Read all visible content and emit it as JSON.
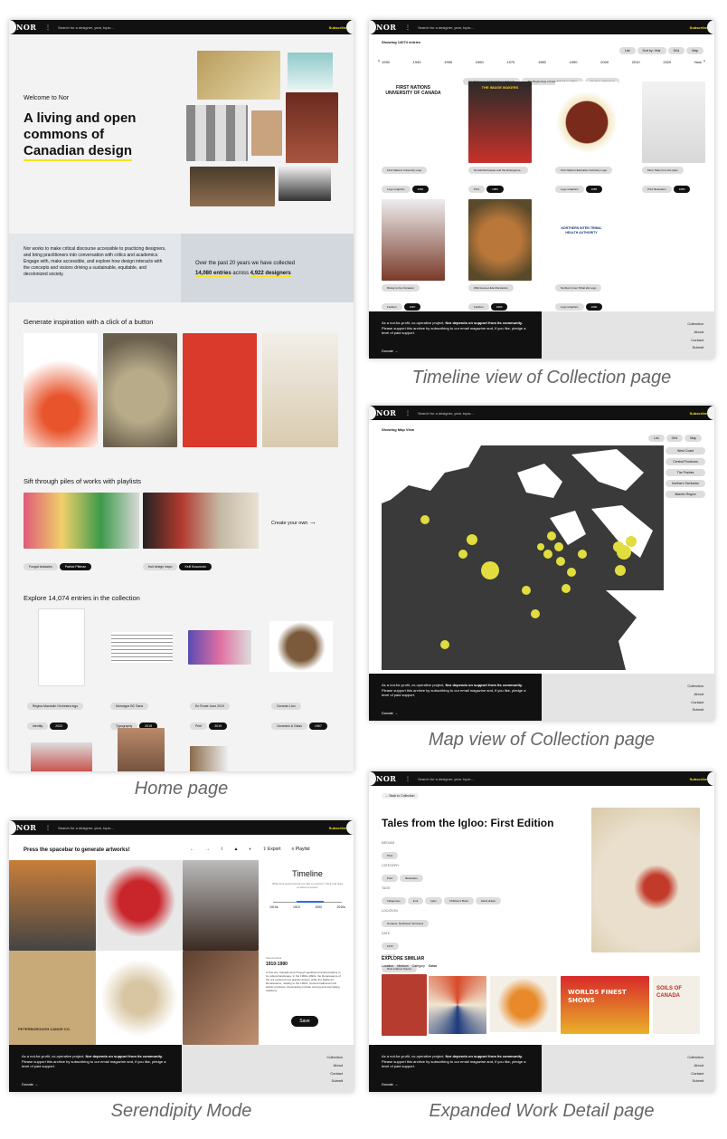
{
  "common": {
    "logo": "NOR",
    "search_placeholder": "Search for a designer, year, topic...",
    "subscribe": "Subscribe",
    "footer_text_a": "As a not-for-profit, co-operative project, ",
    "footer_text_b": "Nor depends on support from its community.",
    "footer_text_c": " Please support this archive by subscribing to our email magazine and, if you like, pledge a level of paid support.",
    "donate": "Donate →",
    "footer_links": [
      "Collection",
      "About",
      "Contact",
      "Submit"
    ]
  },
  "captions": {
    "home": "Home page",
    "timeline": "Timeline view of Collection page",
    "map": "Map view of Collection page",
    "serendipity": "Serendipity Mode",
    "detail": "Expanded Work Detail page"
  },
  "home": {
    "welcome": "Welcome to Nor",
    "headline_1": "A living and open",
    "headline_2": "commons of",
    "headline_3": "Canadian design",
    "mission": "Nor works to make critical discourse accessible to practicing designers, and bring practitioners into conversation with critics and academics. Engage with, make accessible, and explore how design interacts with the concepts and visions driving a sustainable, equitable, and decolonized society.",
    "stats_intro": "Over the past 20 years we have collected",
    "entries": "14,080 entries",
    "across": " across ",
    "designers": "4,922 designers",
    "inspiration_title": "Generate inspiration with a click of a button",
    "sift_title": "Sift through piles of works with  playlists",
    "create": "Create your own",
    "playlists": [
      {
        "name": "Fungal fantasies",
        "author": "Patrick Pittman"
      },
      {
        "name": "fruit design inspo",
        "author": "Kelli Kusumoto"
      }
    ],
    "explore_title": "Explore 14,074 entries in the collection",
    "entries_list": [
      {
        "title": "Regina Mandolin Orchestra logo",
        "cat": "Identity",
        "year": "2023"
      },
      {
        "title": "Monotype BC Sans",
        "cat": "Typography",
        "year": "2019"
      },
      {
        "title": "En Route June 2019",
        "cat": "Print",
        "year": "2019"
      },
      {
        "title": "Ceramic Lion",
        "cat": "Ceramics & Glass",
        "year": "1967"
      }
    ]
  },
  "timeline": {
    "showing": "Showing 14074 entries",
    "list_btn": "List",
    "sort_btn": "Sort by: Year",
    "grid_btn": "Grid",
    "map_btn": "Map",
    "years": [
      "1930",
      "1940",
      "1950",
      "1960",
      "1970",
      "1980",
      "1990",
      "2000",
      "2010",
      "2020",
      "Now"
    ],
    "filters": [
      "Establishment of First Nations Schools",
      "The Beginnings of Inter-Tribal Assemblies",
      "Creation of Nunavut"
    ],
    "cards": [
      {
        "title": "First Nations University Logo",
        "cat": "Logo Graphics",
        "year": "1982"
      },
      {
        "title": "Norval Morrisseau and the Emergence...",
        "cat": "Print",
        "year": "1984"
      },
      {
        "title": "First Nations Education Authority Logo",
        "cat": "Logo Graphics",
        "year": "1985"
      },
      {
        "title": "More Tales from the Igloo",
        "cat": "Print Illustration",
        "year": "1986"
      },
      {
        "title": "Rising to the Occasion",
        "cat": "Fashion",
        "year": "1987"
      },
      {
        "title": "Wild Goose Hide Moccasins",
        "cat": "Fashion",
        "year": "1989"
      },
      {
        "title": "Northern Inter-Tribal HA Logo",
        "cat": "Logo Graphics",
        "year": "1990"
      }
    ],
    "logo_text": "FIRST NATIONS UNIVERSITY OF CANADA",
    "poster_text": "THE IMAGE MAKERS",
    "ha_text": "NORTHERN INTER-TRIBAL HEALTH AUTHORITY"
  },
  "map": {
    "showing": "Showing Map View",
    "regions": [
      "West Coast",
      "Central Provinces",
      "The Prairies",
      "Northern Territories",
      "Atlantic Region"
    ]
  },
  "serendipity": {
    "prompt": "Press the spacebar to generate artworks!",
    "export": "Export",
    "playlist": "Playlist",
    "timeline_title": "Timeline",
    "timeline_sub": "What time period would you like to explore? Click and drag to select a period.",
    "range": [
      "1910s",
      "1910",
      "1990",
      "2010s"
    ],
    "subtitle": "Selected Era",
    "era": "1910-1990",
    "era_text": "In this era, Canada went through significant transformations in its cultural landscape. In the 1960s-1990s, the Renaissance of the era explored new graphic design, while the Nadia Art Renaissance, relating to the 1960s, revived traditional Inuit artistic practices, showcasing intricate carving and storytelling traditions.",
    "save": "Save",
    "canoe_text": "PETERBOROUGH CANOE CO."
  },
  "detail": {
    "back": "← Back to Collection",
    "title": "Tales from the Igloo: First Edition",
    "fields": [
      {
        "label": "MEDIUM",
        "values": [
          "Print"
        ]
      },
      {
        "label": "CATEGORY",
        "values": [
          "Print",
          "Illustration"
        ]
      },
      {
        "label": "TAGS",
        "values": [
          "Indigenous",
          "Inuit",
          "Igloo",
          "Children's Book",
          "Hand-drawn"
        ]
      },
      {
        "label": "LOCATION",
        "values": [
          "Nunavut, Northwest Territories"
        ]
      },
      {
        "label": "DATE",
        "values": [
          "1972"
        ]
      },
      {
        "label": "SOURCE",
        "values": [
          "Nina Andrew Source"
        ]
      }
    ],
    "explore": "EXPLORE SIMILIAR",
    "explore_tabs": [
      "Location",
      "Medium",
      "Category",
      "Color"
    ],
    "thumb_texts": [
      "WORLDS FINEST SHOWS",
      "SOILS OF CANADA"
    ]
  },
  "colors": {
    "accent": "#f5e31a",
    "dark": "#111111",
    "map": "#3a3a3a",
    "dot": "#e2dd3e"
  }
}
